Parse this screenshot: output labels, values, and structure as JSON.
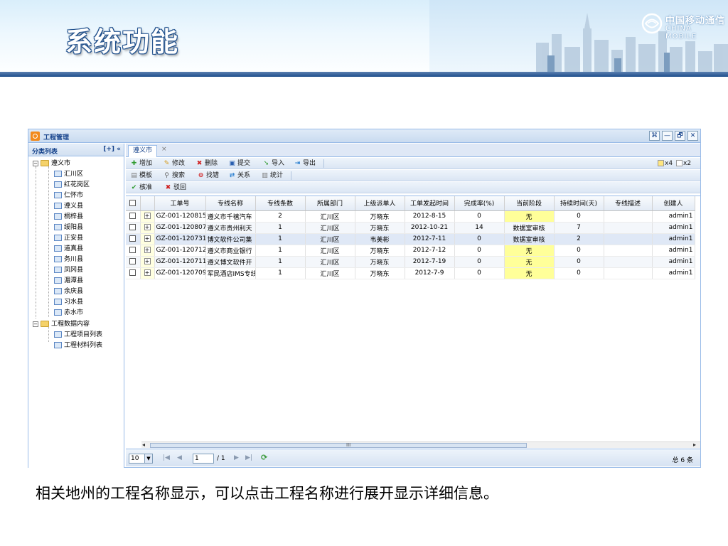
{
  "slide": {
    "title": "系统功能",
    "logo_cn": "中国移动通信",
    "logo_en": "CHINA MOBILE",
    "caption": "相关地州的工程名称显示，可以点击工程名称进行展开显示详细信息。"
  },
  "window": {
    "title": "工程管理",
    "controls": [
      "⌘",
      "—",
      "🗗",
      "✕"
    ]
  },
  "left_panel": {
    "title": "分类列表",
    "tools": "[+] «",
    "tree": {
      "root1": "遵义市",
      "root1_children": [
        "汇川区",
        "红花岗区",
        "仁怀市",
        "遵义县",
        "桐梓县",
        "绥阳县",
        "正安县",
        "道真县",
        "务川县",
        "凤冈县",
        "湄潭县",
        "余庆县",
        "习水县",
        "赤水市"
      ],
      "root2": "工程数据内容",
      "root2_children": [
        "工程项目列表",
        "工程材料列表"
      ]
    }
  },
  "tab": {
    "label": "遵义市",
    "close": "×"
  },
  "toolbar1": {
    "add": "增加",
    "edit": "修改",
    "delete": "删除",
    "submit": "提交",
    "import": "导入",
    "export": "导出",
    "x4": "x4",
    "x2": "x2"
  },
  "toolbar2": {
    "template": "模板",
    "search": "搜索",
    "find_error": "找错",
    "relation": "关系",
    "stats": "统计"
  },
  "toolbar3": {
    "approve": "核准",
    "reject": "驳回"
  },
  "grid": {
    "columns": [
      "工单号",
      "专线名称",
      "专线条数",
      "所属部门",
      "上级派单人",
      "工单发起时间",
      "完成率(%)",
      "当前阶段",
      "持续时间(天)",
      "专线描述",
      "创建人"
    ],
    "rows": [
      [
        "GZ-001-120815-",
        "遵义市千禧汽车",
        "2",
        "汇川区",
        "万晓东",
        "2012-8-15",
        "0",
        "无",
        "0",
        "",
        "admin1"
      ],
      [
        "GZ-001-120807-",
        "遵义市贵州利天",
        "1",
        "汇川区",
        "万晓东",
        "2012-10-21",
        "14",
        "数据室审核",
        "7",
        "",
        "admin1"
      ],
      [
        "GZ-001-120731-",
        "博文软件公司集",
        "1",
        "汇川区",
        "韦美彬",
        "2012-7-11",
        "0",
        "数据室审核",
        "2",
        "",
        "admin1"
      ],
      [
        "GZ-001-120712-",
        "遵义市商业银行",
        "1",
        "汇川区",
        "万晓东",
        "2012-7-12",
        "0",
        "无",
        "0",
        "",
        "admin1"
      ],
      [
        "GZ-001-120711-",
        "遵义博文软件开",
        "1",
        "汇川区",
        "万晓东",
        "2012-7-19",
        "0",
        "无",
        "0",
        "",
        "admin1"
      ],
      [
        "GZ-001-120709-",
        "军民酒店IMS专线",
        "1",
        "汇川区",
        "万晓东",
        "2012-7-9",
        "0",
        "无",
        "0",
        "",
        "admin1"
      ]
    ]
  },
  "pager": {
    "page_size": "10",
    "current_page": "1",
    "total_pages": "/ 1",
    "total_count": "总 6 条",
    "scroll_mark": "III"
  },
  "colors": {
    "accent": "#15428b",
    "border": "#99bbe8",
    "stage_highlight": "#ffff99"
  }
}
